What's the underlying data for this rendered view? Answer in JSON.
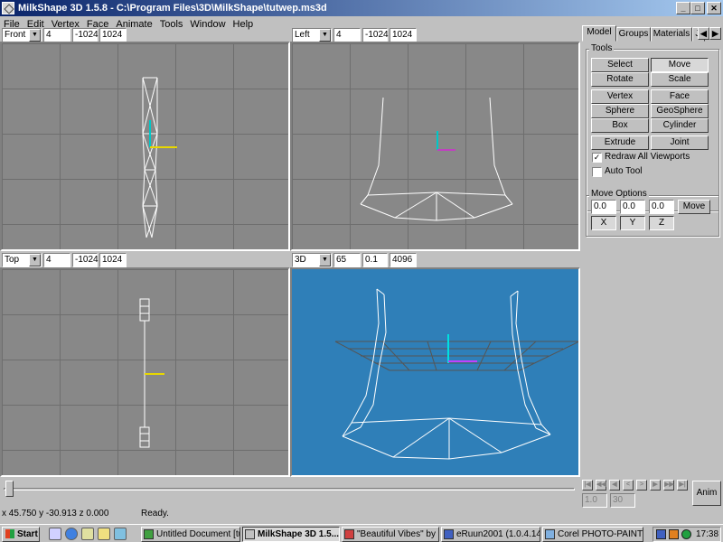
{
  "window": {
    "title": "MilkShape 3D 1.5.8 - C:\\Program Files\\3D\\MilkShape\\tutwep.ms3d",
    "min": "_",
    "max": "□",
    "close": "✕"
  },
  "menu": [
    "File",
    "Edit",
    "Vertex",
    "Face",
    "Animate",
    "Tools",
    "Window",
    "Help"
  ],
  "viewports": {
    "front": {
      "view": "Front",
      "a": "4",
      "b": "-1024",
      "c": "1024"
    },
    "left": {
      "view": "Left",
      "a": "4",
      "b": "-1024",
      "c": "1024"
    },
    "top": {
      "view": "Top",
      "a": "4",
      "b": "-1024",
      "c": "1024"
    },
    "three_d": {
      "view": "3D",
      "a": "65",
      "b": "0.1",
      "c": "4096"
    }
  },
  "panel": {
    "tabs": [
      "Model",
      "Groups",
      "Materials",
      "Ji"
    ],
    "tools_label": "Tools",
    "tools": [
      [
        "Select",
        "Move"
      ],
      [
        "Rotate",
        "Scale"
      ],
      [
        "Vertex",
        "Face"
      ],
      [
        "Sphere",
        "GeoSphere"
      ],
      [
        "Box",
        "Cylinder"
      ],
      [
        "Extrude",
        "Joint"
      ]
    ],
    "redraw_label": "Redraw All Viewports",
    "redraw_checked": true,
    "autotool_label": "Auto Tool",
    "autotool_checked": false,
    "move_options_label": "Move Options",
    "move_x": "0.0",
    "move_y": "0.0",
    "move_z": "0.0",
    "move_button": "Move",
    "axis_x": "X",
    "axis_y": "Y",
    "axis_z": "Z"
  },
  "timeline": {
    "frame": "1.0",
    "total": "30",
    "anim_button": "Anim"
  },
  "status": {
    "coords": "x 45.750 y -30.913 z 0.000",
    "message": "Ready."
  },
  "taskbar": {
    "start": "Start",
    "tasks": [
      "Untitled Document [tut...",
      "MilkShape 3D 1.5...",
      "\"Beautiful Vibes\" by S...",
      "eRuun2001 (1.0.4.14)",
      "Corel PHOTO-PAINT ..."
    ],
    "clock": "17:38"
  },
  "colors": {
    "titlebar": "#0a246a",
    "viewport_gray": "#888888",
    "viewport_3d": "#2f7fb8"
  }
}
